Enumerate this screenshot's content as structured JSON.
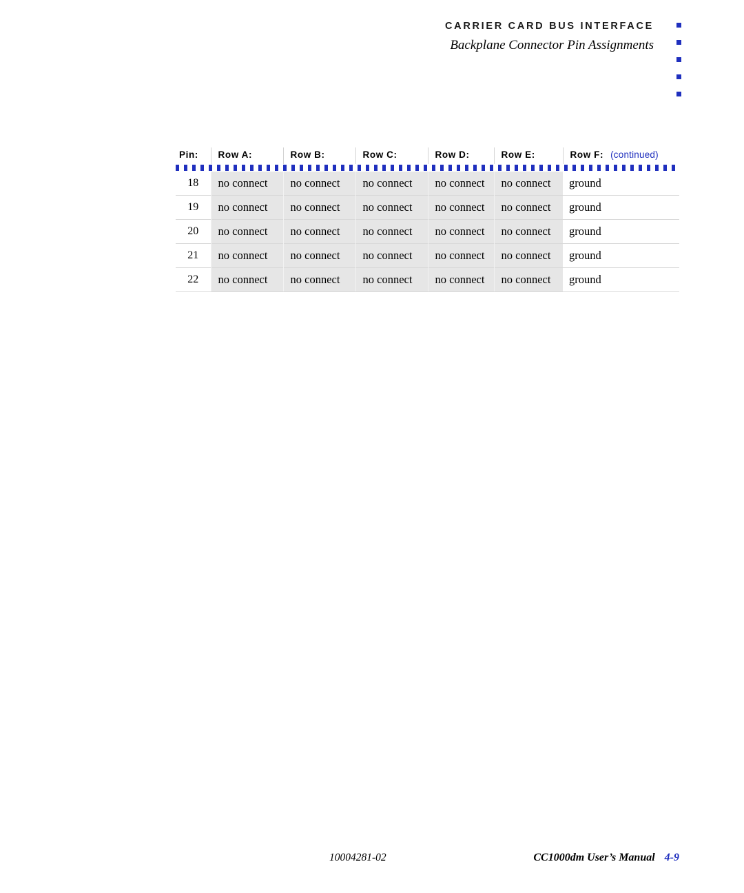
{
  "header": {
    "title": "CARRIER CARD BUS INTERFACE",
    "subtitle": "Backplane Connector Pin Assignments",
    "edge_marker_icon": "blue-square-dot",
    "edge_marker_count": 5,
    "accent_color": "#1f2fbe"
  },
  "table": {
    "columns": [
      "Pin:",
      "Row A:",
      "Row B:",
      "Row C:",
      "Row D:",
      "Row E:",
      "Row F:"
    ],
    "continued_note": "(continued)",
    "rows": [
      {
        "pin": "18",
        "row_a": "no connect",
        "row_b": "no connect",
        "row_c": "no connect",
        "row_d": "no connect",
        "row_e": "no connect",
        "row_f": "ground"
      },
      {
        "pin": "19",
        "row_a": "no connect",
        "row_b": "no connect",
        "row_c": "no connect",
        "row_d": "no connect",
        "row_e": "no connect",
        "row_f": "ground"
      },
      {
        "pin": "20",
        "row_a": "no connect",
        "row_b": "no connect",
        "row_c": "no connect",
        "row_d": "no connect",
        "row_e": "no connect",
        "row_f": "ground"
      },
      {
        "pin": "21",
        "row_a": "no connect",
        "row_b": "no connect",
        "row_c": "no connect",
        "row_d": "no connect",
        "row_e": "no connect",
        "row_f": "ground"
      },
      {
        "pin": "22",
        "row_a": "no connect",
        "row_b": "no connect",
        "row_c": "no connect",
        "row_d": "no connect",
        "row_e": "no connect",
        "row_f": "ground"
      }
    ]
  },
  "footer": {
    "document_number": "10004281-02",
    "manual_title": "CC1000dm User’s Manual",
    "page_number": "4-9"
  }
}
